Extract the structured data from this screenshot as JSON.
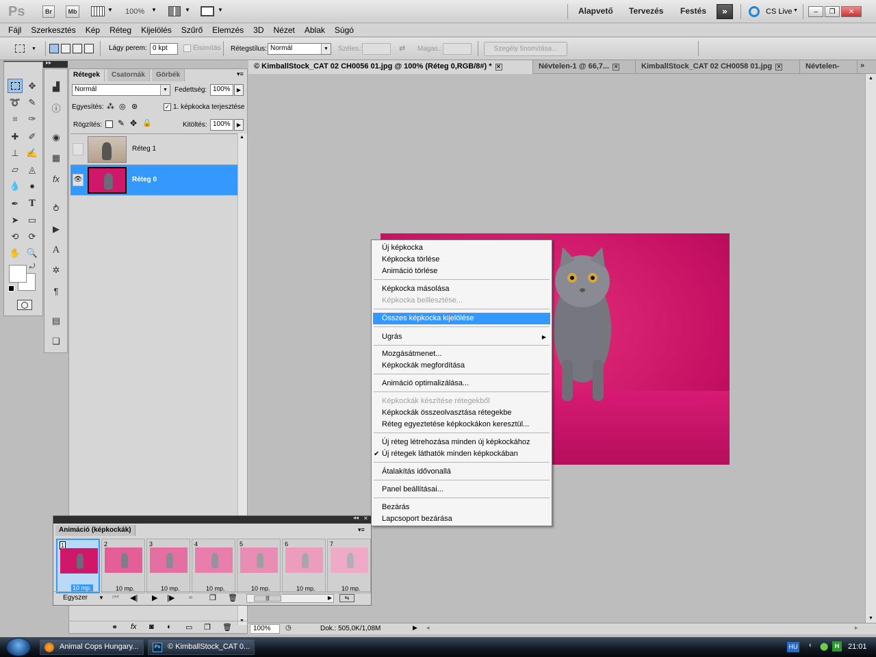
{
  "app": {
    "logo": "Ps",
    "bridge_btn": "Br",
    "minibridge_btn": "Mb",
    "zoom": "100%",
    "workspaces": [
      "Alapvető",
      "Tervezés",
      "Festés"
    ],
    "cslive": "CS Live"
  },
  "menu": [
    "Fájl",
    "Szerkesztés",
    "Kép",
    "Réteg",
    "Kijelölés",
    "Szűrő",
    "Elemzés",
    "3D",
    "Nézet",
    "Ablak",
    "Súgó"
  ],
  "options": {
    "feather_label": "Lágy perem:",
    "feather_value": "0 kpt",
    "antialias_label": "Élsimítás",
    "style_label": "Rétegstílus:",
    "style_value": "Normál",
    "width_label": "Széles.:",
    "height_label": "Magas.:",
    "refine_btn": "Szegély finomítása..."
  },
  "layers_panel": {
    "tabs": [
      "Rétegek",
      "Csatornák",
      "Görbék"
    ],
    "blend_mode": "Normál",
    "opacity_label": "Fedettség:",
    "opacity_value": "100%",
    "unify_label": "Egyesítés:",
    "propagate_label": "1. képkocka terjesztése",
    "lock_label": "Rögzítés:",
    "fill_label": "Kitöltés:",
    "fill_value": "100%",
    "layers": [
      {
        "name": "Réteg 1",
        "selected": false
      },
      {
        "name": "Réteg 0",
        "selected": true
      }
    ]
  },
  "doc_tabs": [
    {
      "title": "© KimballStock_CAT 02 CH0056 01.jpg @ 100% (Réteg 0,RGB/8#) *",
      "active": true
    },
    {
      "title": "Névtelen-1 @ 66,7...",
      "active": false
    },
    {
      "title": "KimballStock_CAT 02 CH0058 01.jpg",
      "active": false
    },
    {
      "title": "Névtelen-",
      "active": false
    }
  ],
  "context_menu": {
    "items": [
      {
        "label": "Új képkocka",
        "state": "normal"
      },
      {
        "label": "Képkocka törlése",
        "state": "normal"
      },
      {
        "label": "Animáció törlése",
        "state": "normal"
      },
      {
        "label": "Képkocka másolása",
        "state": "normal"
      },
      {
        "label": "Képkocka beillesztése...",
        "state": "disabled"
      },
      {
        "label": "Összes képkocka kijelölése",
        "state": "highlighted"
      },
      {
        "label": "Ugrás",
        "state": "submenu"
      },
      {
        "label": "Mozgásátmenet...",
        "state": "normal"
      },
      {
        "label": "Képkockák megfordítása",
        "state": "normal"
      },
      {
        "label": "Animáció optimalizálása...",
        "state": "normal"
      },
      {
        "label": "Képkockák készítése rétegekből",
        "state": "disabled"
      },
      {
        "label": "Képkockák összeolvasztása rétegekbe",
        "state": "normal"
      },
      {
        "label": "Réteg egyeztetése képkockákon keresztül...",
        "state": "normal"
      },
      {
        "label": "Új réteg létrehozása minden új képkockához",
        "state": "normal"
      },
      {
        "label": "Új rétegek láthatók minden képkockában",
        "state": "checked"
      },
      {
        "label": "Átalakítás idővonallá",
        "state": "normal"
      },
      {
        "label": "Panel beállításai...",
        "state": "normal"
      },
      {
        "label": "Bezárás",
        "state": "normal"
      },
      {
        "label": "Lapcsoport bezárása",
        "state": "normal"
      }
    ]
  },
  "animation_panel": {
    "title": "Animáció (képkockák)",
    "loop": "Egyszer",
    "frames": [
      {
        "num": "1",
        "time": "10 mp."
      },
      {
        "num": "2",
        "time": "10 mp."
      },
      {
        "num": "3",
        "time": "10 mp."
      },
      {
        "num": "4",
        "time": "10 mp."
      },
      {
        "num": "5",
        "time": "10 mp."
      },
      {
        "num": "6",
        "time": "10 mp."
      },
      {
        "num": "7",
        "time": "10 mp."
      }
    ]
  },
  "status": {
    "zoom": "100%",
    "doc": "Dok.: 505,0K/1,08M"
  },
  "taskbar": {
    "tasks": [
      "Animal Cops Hungary...",
      "© KimballStock_CAT 0..."
    ],
    "lang": "HU",
    "clock": "21:01"
  },
  "colors": {
    "accent": "#3399ff",
    "image_bg": "#d0186a"
  }
}
